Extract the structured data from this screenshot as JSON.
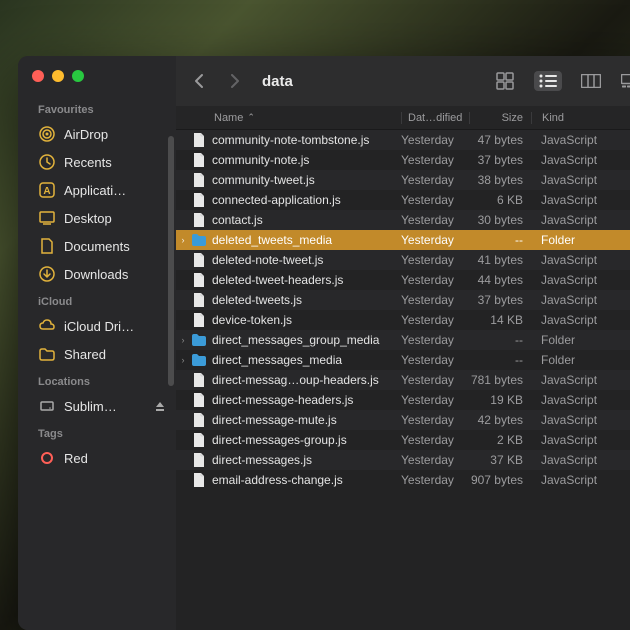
{
  "window": {
    "title": "data"
  },
  "sidebar": {
    "sections": [
      {
        "label": "Favourites",
        "items": [
          {
            "icon": "airdrop",
            "label": "AirDrop"
          },
          {
            "icon": "recents",
            "label": "Recents"
          },
          {
            "icon": "applications",
            "label": "Applicati…"
          },
          {
            "icon": "desktop",
            "label": "Desktop"
          },
          {
            "icon": "documents",
            "label": "Documents"
          },
          {
            "icon": "downloads",
            "label": "Downloads"
          }
        ]
      },
      {
        "label": "iCloud",
        "items": [
          {
            "icon": "icloud",
            "label": "iCloud Dri…"
          },
          {
            "icon": "shared",
            "label": "Shared"
          }
        ]
      },
      {
        "label": "Locations",
        "items": [
          {
            "icon": "disk",
            "label": "Sublim…"
          }
        ]
      },
      {
        "label": "Tags",
        "items": [
          {
            "icon": "tag-red",
            "label": "Red"
          }
        ]
      }
    ]
  },
  "columns": {
    "name": "Name",
    "date": "Dat…dified",
    "size": "Size",
    "kind": "Kind"
  },
  "files": [
    {
      "name": "community-note-tombstone.js",
      "date": "Yesterday",
      "size": "47 bytes",
      "kind": "JavaScript",
      "type": "file"
    },
    {
      "name": "community-note.js",
      "date": "Yesterday",
      "size": "37 bytes",
      "kind": "JavaScript",
      "type": "file"
    },
    {
      "name": "community-tweet.js",
      "date": "Yesterday",
      "size": "38 bytes",
      "kind": "JavaScript",
      "type": "file"
    },
    {
      "name": "connected-application.js",
      "date": "Yesterday",
      "size": "6 KB",
      "kind": "JavaScript",
      "type": "file"
    },
    {
      "name": "contact.js",
      "date": "Yesterday",
      "size": "30 bytes",
      "kind": "JavaScript",
      "type": "file"
    },
    {
      "name": "deleted_tweets_media",
      "date": "Yesterday",
      "size": "--",
      "kind": "Folder",
      "type": "folder",
      "selected": true,
      "disclosure": true
    },
    {
      "name": "deleted-note-tweet.js",
      "date": "Yesterday",
      "size": "41 bytes",
      "kind": "JavaScript",
      "type": "file"
    },
    {
      "name": "deleted-tweet-headers.js",
      "date": "Yesterday",
      "size": "44 bytes",
      "kind": "JavaScript",
      "type": "file"
    },
    {
      "name": "deleted-tweets.js",
      "date": "Yesterday",
      "size": "37 bytes",
      "kind": "JavaScript",
      "type": "file"
    },
    {
      "name": "device-token.js",
      "date": "Yesterday",
      "size": "14 KB",
      "kind": "JavaScript",
      "type": "file"
    },
    {
      "name": "direct_messages_group_media",
      "date": "Yesterday",
      "size": "--",
      "kind": "Folder",
      "type": "folder",
      "disclosure": true
    },
    {
      "name": "direct_messages_media",
      "date": "Yesterday",
      "size": "--",
      "kind": "Folder",
      "type": "folder",
      "disclosure": true
    },
    {
      "name": "direct-messag…oup-headers.js",
      "date": "Yesterday",
      "size": "781 bytes",
      "kind": "JavaScript",
      "type": "file"
    },
    {
      "name": "direct-message-headers.js",
      "date": "Yesterday",
      "size": "19 KB",
      "kind": "JavaScript",
      "type": "file"
    },
    {
      "name": "direct-message-mute.js",
      "date": "Yesterday",
      "size": "42 bytes",
      "kind": "JavaScript",
      "type": "file"
    },
    {
      "name": "direct-messages-group.js",
      "date": "Yesterday",
      "size": "2 KB",
      "kind": "JavaScript",
      "type": "file"
    },
    {
      "name": "direct-messages.js",
      "date": "Yesterday",
      "size": "37 KB",
      "kind": "JavaScript",
      "type": "file"
    },
    {
      "name": "email-address-change.js",
      "date": "Yesterday",
      "size": "907 bytes",
      "kind": "JavaScript",
      "type": "file"
    }
  ]
}
